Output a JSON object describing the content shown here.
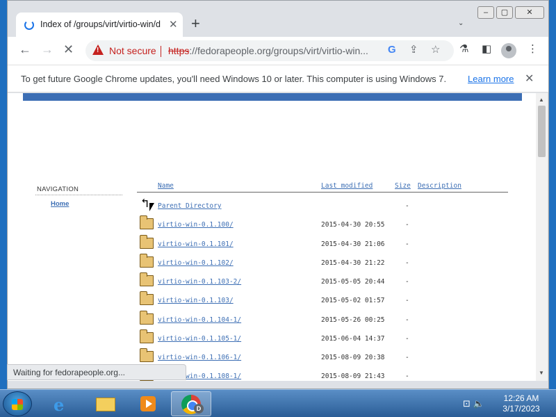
{
  "browser": {
    "tab_title": "Index of /groups/virt/virtio-win/d",
    "new_tab_glyph": "+",
    "close_tab_glyph": "✕",
    "security_label": "Not secure",
    "url_scheme": "https",
    "url_rest": "://fedorapeople.org/groups/virt/virtio-win...",
    "url_host": "fedorapeople.org",
    "url_path": "/groups/virt/virtio-win..."
  },
  "infobar": {
    "message": "To get future Google Chrome updates, you'll need Windows 10 or later. This computer is using Windows 7.",
    "learn_more": "Learn more"
  },
  "page": {
    "nav_title": "NAVIGATION",
    "nav_home": "Home",
    "headers": {
      "name": "Name",
      "last_modified": "Last modified",
      "size": "Size",
      "description": "Description"
    },
    "parent": {
      "name": "Parent Directory",
      "size": "-"
    },
    "rows": [
      {
        "name": "virtio-win-0.1.100/",
        "date": "2015-04-30 20:55",
        "size": "-"
      },
      {
        "name": "virtio-win-0.1.101/",
        "date": "2015-04-30 21:06",
        "size": "-"
      },
      {
        "name": "virtio-win-0.1.102/",
        "date": "2015-04-30 21:22",
        "size": "-"
      },
      {
        "name": "virtio-win-0.1.103-2/",
        "date": "2015-05-05 20:44",
        "size": "-"
      },
      {
        "name": "virtio-win-0.1.103/",
        "date": "2015-05-02 01:57",
        "size": "-"
      },
      {
        "name": "virtio-win-0.1.104-1/",
        "date": "2015-05-26 00:25",
        "size": "-"
      },
      {
        "name": "virtio-win-0.1.105-1/",
        "date": "2015-06-04 14:37",
        "size": "-"
      },
      {
        "name": "virtio-win-0.1.106-1/",
        "date": "2015-08-09 20:38",
        "size": "-"
      },
      {
        "name": "virtio-win-0.1.108-1/",
        "date": "2015-08-09 21:43",
        "size": "-"
      }
    ]
  },
  "status": {
    "text": "Waiting for fedorapeople.org..."
  },
  "taskbar": {
    "chrome_badge": "D",
    "time": "12:26 AM",
    "date": "3/17/2023"
  },
  "colors": {
    "link": "#3c6eb4",
    "warning": "#c5221f",
    "banner": "#3c6eb4"
  }
}
